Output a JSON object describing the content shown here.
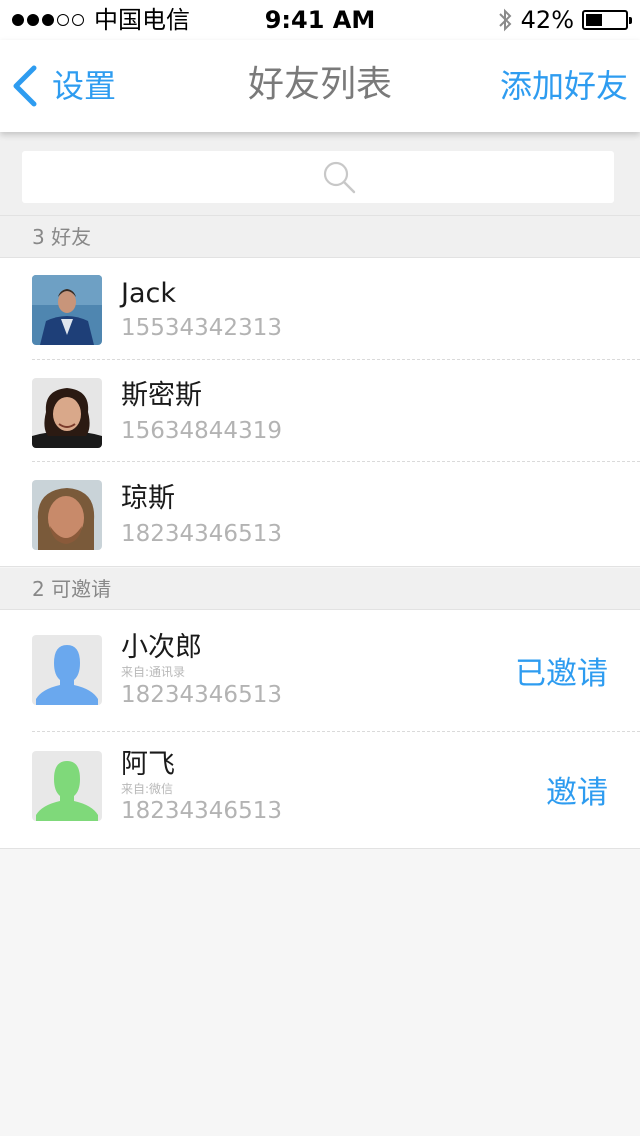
{
  "status_bar": {
    "carrier": "中国电信",
    "time": "9:41 AM",
    "battery": "42%",
    "battery_level": 0.42
  },
  "nav": {
    "back_label": "设置",
    "title": "好友列表",
    "action_label": "添加好友"
  },
  "search": {
    "placeholder": ""
  },
  "friends_section": {
    "header": "3 好友",
    "items": [
      {
        "name": "Jack",
        "phone": "15534342313"
      },
      {
        "name": "斯密斯",
        "phone": "15634844319"
      },
      {
        "name": "琼斯",
        "phone": "18234346513"
      }
    ]
  },
  "invite_section": {
    "header": "2 可邀请",
    "items": [
      {
        "name": "小次郎",
        "source": "来自:通讯录",
        "phone": "18234346513",
        "action": "已邀请",
        "avatar_color": "#6aa8ee"
      },
      {
        "name": "阿飞",
        "source": "来自:微信",
        "phone": "18234346513",
        "action": "邀请",
        "avatar_color": "#7fd97a"
      }
    ]
  },
  "colors": {
    "accent": "#2e9cf0",
    "title_gray": "#7a7a7a"
  }
}
